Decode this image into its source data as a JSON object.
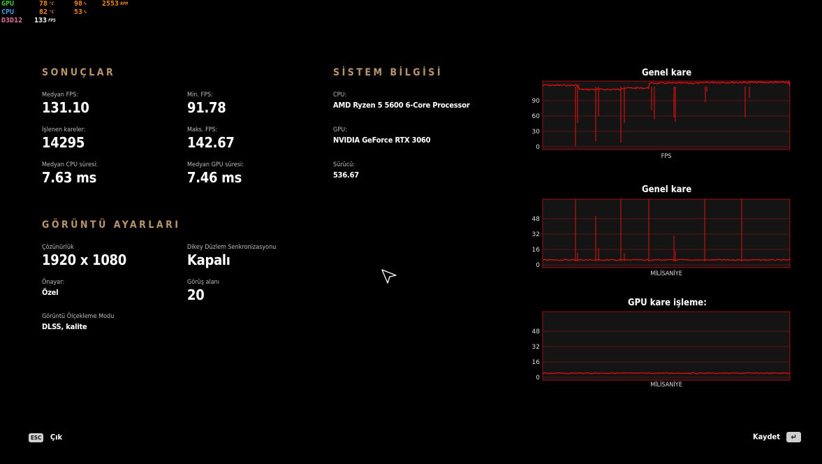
{
  "osd": {
    "rows": [
      {
        "label": "GPU",
        "label_color": "#3fc53f",
        "v1": "78",
        "u1": "°C",
        "v2": "98",
        "u2": "%",
        "v3": "2553",
        "u3": "RPM"
      },
      {
        "label": "CPU",
        "label_color": "#3aa0e0",
        "v1": "82",
        "u1": "°C",
        "v2": "53",
        "u2": "%"
      },
      {
        "label": "D3D12",
        "label_color": "#e07a9a",
        "v1": "133",
        "u1": "FPS"
      }
    ],
    "value_color": "#f08a24"
  },
  "results": {
    "title": "SONUÇLAR",
    "median_fps": {
      "label": "Medyan FPS:",
      "value": "131.10"
    },
    "min_fps": {
      "label": "Min. FPS:",
      "value": "91.78"
    },
    "frames": {
      "label": "İşlenen kareler:",
      "value": "14295"
    },
    "max_fps": {
      "label": "Maks. FPS:",
      "value": "142.67"
    },
    "cpu_time": {
      "label": "Medyan CPU süresi:",
      "value": "7.63 ms"
    },
    "gpu_time": {
      "label": "Medyan GPU süresi:",
      "value": "7.46 ms"
    }
  },
  "display": {
    "title": "GÖRÜNTÜ AYARLARI",
    "resolution": {
      "label": "Çözünürlük",
      "value": "1920 x 1080"
    },
    "vsync": {
      "label": "Dikey Düzlem Senkronizasyonu",
      "value": "Kapalı"
    },
    "preset": {
      "label": "Önayar:",
      "value": "Özel"
    },
    "fov": {
      "label": "Görüş alanı",
      "value": "20"
    },
    "upscaling": {
      "label": "Görüntü Ölçekleme Modu",
      "value": "DLSS, kalite"
    }
  },
  "system": {
    "title": "SİSTEM BİLGİSİ",
    "cpu": {
      "label": "CPU:",
      "value": "AMD Ryzen 5 5600 6-Core Processor"
    },
    "gpu": {
      "label": "GPU:",
      "value": "NVIDIA GeForce RTX 3060"
    },
    "driver": {
      "label": "Sürücü:",
      "value": "536.67"
    }
  },
  "charts": [
    {
      "title": "Genel kare",
      "xlabel": "FPS",
      "yticks": [
        "0",
        "30",
        "60",
        "90"
      ],
      "accent": "#e01010"
    },
    {
      "title": "Genel kare",
      "xlabel": "MİLİSANİYE",
      "yticks": [
        "0",
        "16",
        "32",
        "48"
      ],
      "accent": "#e01010"
    },
    {
      "title": "GPU kare işleme:",
      "xlabel": "MİLİSANİYE",
      "yticks": [
        "0",
        "16",
        "32",
        "48"
      ],
      "accent": "#e01010"
    }
  ],
  "footer": {
    "esc_key": "ESC",
    "exit_label": "Çık",
    "save_label": "Kaydet",
    "enter_key": "↵"
  }
}
